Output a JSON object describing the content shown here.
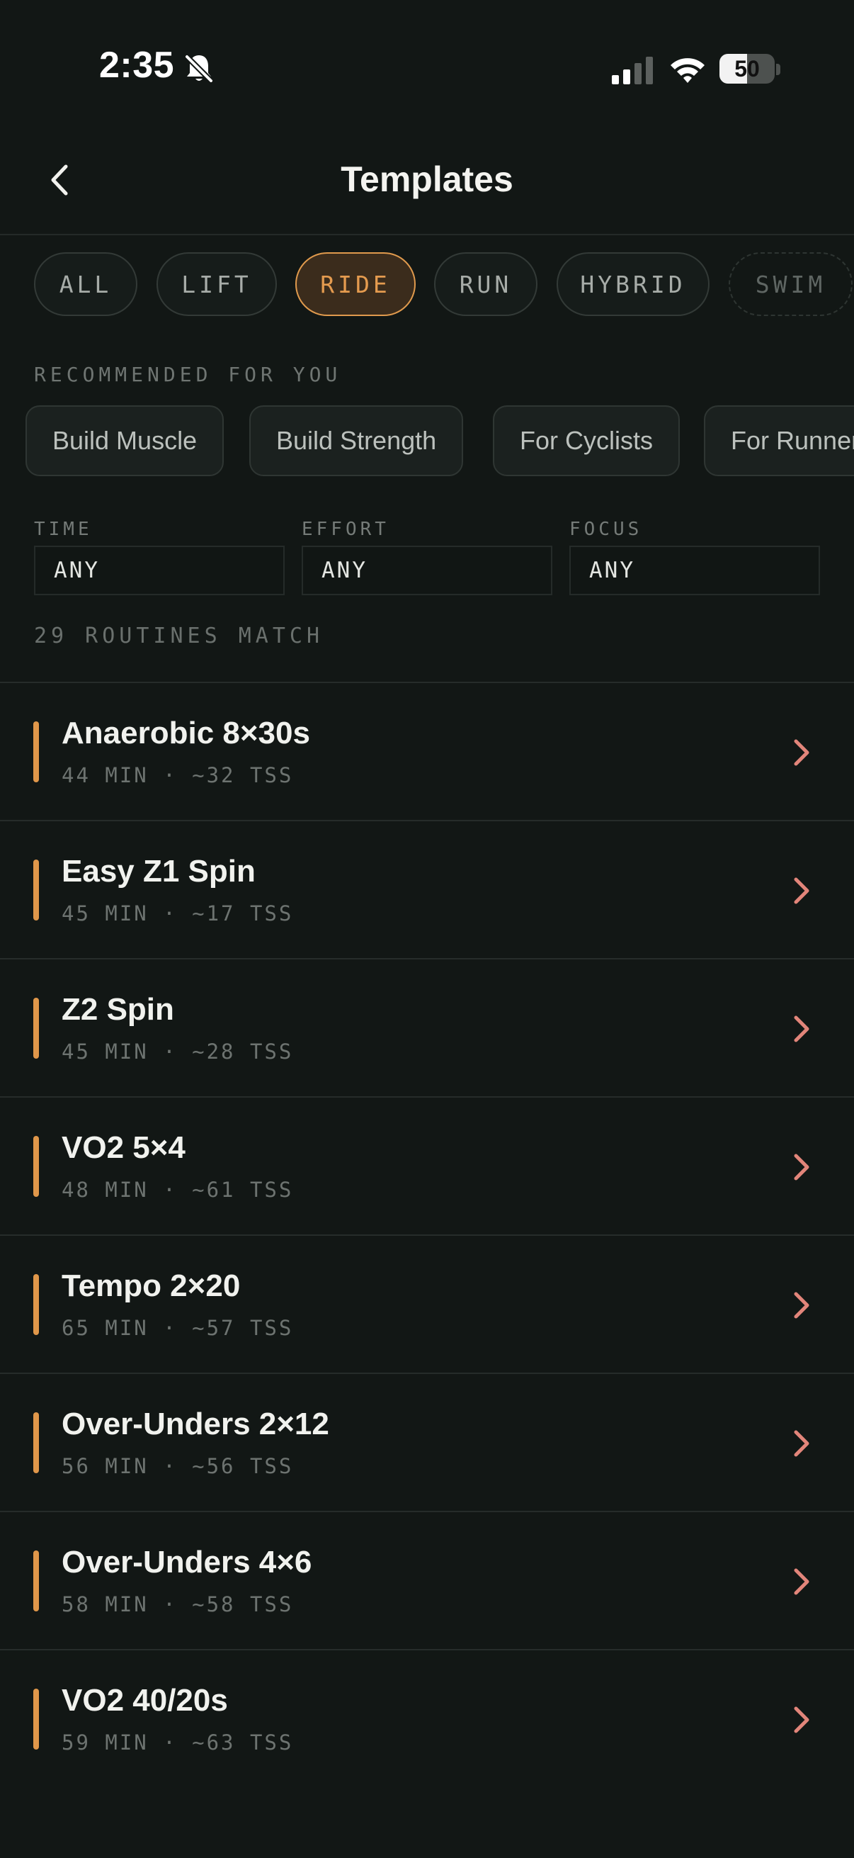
{
  "status": {
    "time": "2:35",
    "battery": "50",
    "battery_level": 0.5
  },
  "header": {
    "title": "Templates"
  },
  "categories": [
    {
      "label": "ALL",
      "active": false
    },
    {
      "label": "LIFT",
      "active": false
    },
    {
      "label": "RIDE",
      "active": true
    },
    {
      "label": "RUN",
      "active": false
    },
    {
      "label": "HYBRID",
      "active": false
    },
    {
      "label": "SWIM",
      "active": false
    }
  ],
  "recommended": {
    "label": "RECOMMENDED FOR YOU",
    "items": [
      "Build Muscle",
      "Build Strength",
      "For Cyclists",
      "For Runners"
    ]
  },
  "filters": [
    {
      "label": "TIME",
      "value": "ANY"
    },
    {
      "label": "EFFORT",
      "value": "ANY"
    },
    {
      "label": "FOCUS",
      "value": "ANY"
    }
  ],
  "match_count": "29 ROUTINES MATCH",
  "routines": [
    {
      "name": "Anaerobic 8×30s",
      "meta": "44 MIN · ~32 TSS"
    },
    {
      "name": "Easy Z1 Spin",
      "meta": "45 MIN · ~17 TSS"
    },
    {
      "name": "Z2 Spin",
      "meta": "45 MIN · ~28 TSS"
    },
    {
      "name": "VO2 5×4",
      "meta": "48 MIN · ~61 TSS"
    },
    {
      "name": "Tempo 2×20",
      "meta": "65 MIN · ~57 TSS"
    },
    {
      "name": "Over-Unders 2×12",
      "meta": "56 MIN · ~56 TSS"
    },
    {
      "name": "Over-Unders 4×6",
      "meta": "58 MIN · ~58 TSS"
    },
    {
      "name": "VO2 40/20s",
      "meta": "59 MIN · ~63 TSS"
    }
  ],
  "colors": {
    "accent": "#e0974a",
    "chevron": "#e2857a",
    "background": "#121715"
  }
}
